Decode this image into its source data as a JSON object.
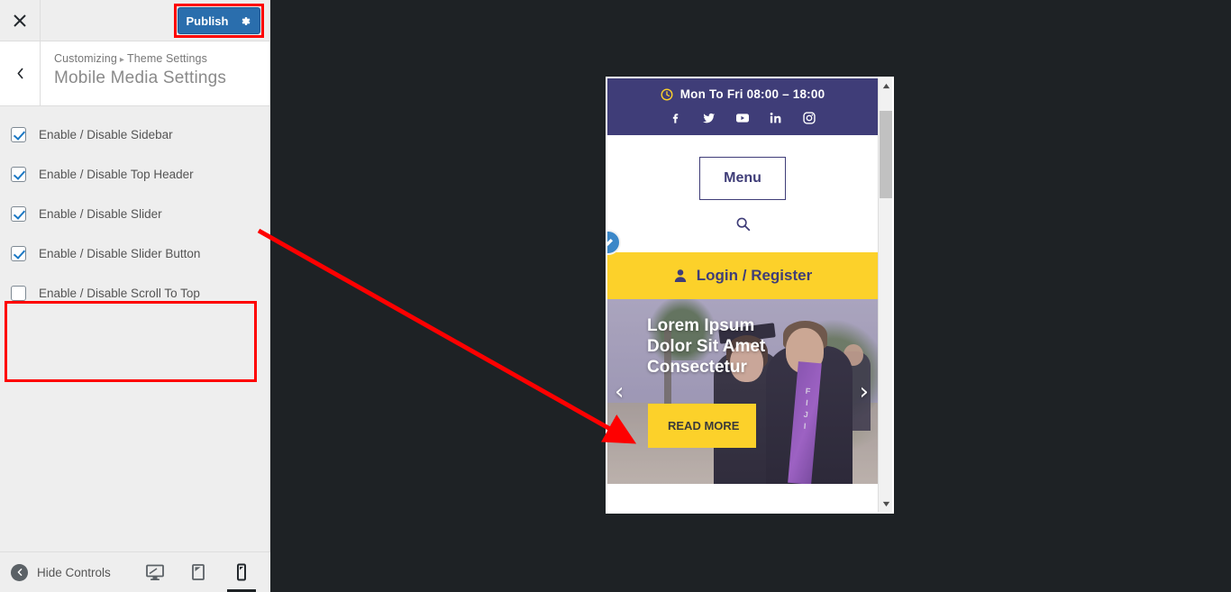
{
  "customizer": {
    "close_label": "×",
    "close_icon": "close-icon",
    "publish_label": "Publish",
    "publish_gear_icon": "gear-icon",
    "back_icon": "chevron-left-icon",
    "breadcrumb": {
      "root": "Customizing",
      "separator": "▸",
      "parent": "Theme Settings"
    },
    "panel_title": "Mobile Media Settings",
    "options": [
      {
        "label": "Enable / Disable Sidebar",
        "checked": true
      },
      {
        "label": "Enable / Disable Top Header",
        "checked": true
      },
      {
        "label": "Enable / Disable Slider",
        "checked": true
      },
      {
        "label": "Enable / Disable Slider Button",
        "checked": true
      },
      {
        "label": "Enable / Disable Scroll To Top",
        "checked": false
      }
    ],
    "footer": {
      "hide_controls_label": "Hide Controls",
      "hide_controls_icon": "collapse-arrow-icon",
      "devices": [
        {
          "name": "desktop",
          "icon": "desktop-icon",
          "active": false
        },
        {
          "name": "tablet",
          "icon": "tablet-icon",
          "active": false
        },
        {
          "name": "mobile",
          "icon": "mobile-icon",
          "active": true
        }
      ]
    }
  },
  "preview": {
    "edit_shortcut_icon": "pencil-edit-icon",
    "top_header": {
      "clock_icon": "clock-icon",
      "hours": "Mon To Fri 08:00 – 18:00",
      "social": [
        {
          "name": "facebook-icon"
        },
        {
          "name": "twitter-icon"
        },
        {
          "name": "youtube-icon"
        },
        {
          "name": "linkedin-icon"
        },
        {
          "name": "instagram-icon"
        }
      ]
    },
    "menu_button": "Menu",
    "search_icon": "search-icon",
    "login": {
      "icon": "user-icon",
      "label": "Login / Register"
    },
    "slider": {
      "caption": "Lorem Ipsum Dolor Sit Amet Consectetur",
      "button_label": "READ MORE",
      "prev_icon": "chevron-left-icon",
      "next_icon": "chevron-right-icon",
      "sash_text": "FIJI"
    },
    "scrollbar": {
      "up_icon": "caret-up-icon",
      "down_icon": "caret-down-icon"
    }
  },
  "colors": {
    "publish_blue": "#2a6ead",
    "annotation_red": "#fe0000",
    "site_purple": "#3f3d78",
    "site_yellow": "#fcd12a",
    "panel_bg": "#eeeeee",
    "preview_bg": "#1e2225"
  }
}
